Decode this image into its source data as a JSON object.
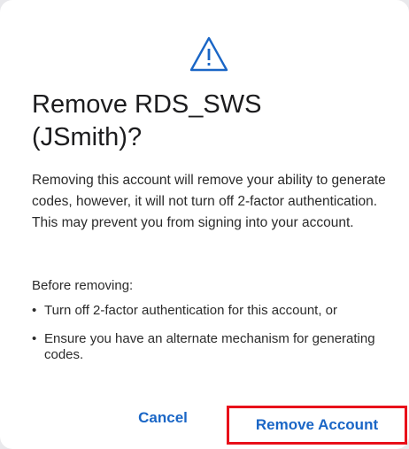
{
  "dialog": {
    "icon": "warning-triangle-icon",
    "title": "Remove RDS_SWS (JSmith)?",
    "message": "Removing this account will remove your ability to generate codes, however, it will not turn off 2-factor authentication. This may prevent you from signing into your account.",
    "before_label": "Before removing:",
    "bullets": [
      "Turn off 2-factor authentication for this account, or",
      "Ensure you have an alternate mechanism for generating codes."
    ],
    "cancel_label": "Cancel",
    "remove_label": "Remove Account",
    "accent_color": "#1a66c6",
    "highlight_color": "#e8101a"
  }
}
